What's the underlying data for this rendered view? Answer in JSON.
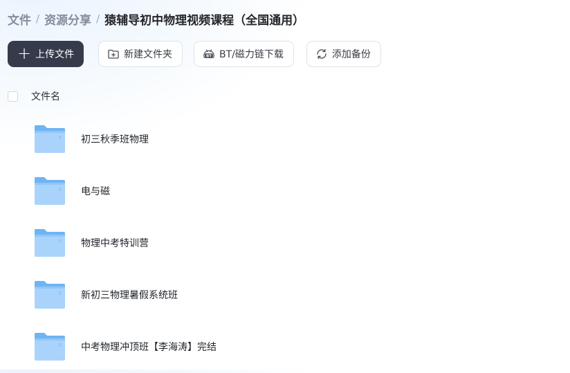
{
  "breadcrumb": {
    "items": [
      "文件",
      "资源分享"
    ],
    "separator": "/",
    "current": "猿辅导初中物理视频课程（全国通用）"
  },
  "toolbar": {
    "upload_label": "上传文件",
    "new_folder_label": "新建文件夹",
    "bt_label": "BT/磁力链下载",
    "backup_label": "添加备份"
  },
  "list": {
    "column_name": "文件名",
    "files": [
      {
        "name": "初三秋季班物理",
        "type": "folder"
      },
      {
        "name": "电与磁",
        "type": "folder"
      },
      {
        "name": "物理中考特训营",
        "type": "folder"
      },
      {
        "name": "新初三物理暑假系统班",
        "type": "folder"
      },
      {
        "name": "中考物理冲顶班【李海涛】完结",
        "type": "folder"
      }
    ]
  },
  "colors": {
    "primary_button": "#363b4c",
    "folder_light": "#a9d3fb",
    "folder_dark": "#6fb4f3"
  },
  "icons": {
    "upload": "plus-icon",
    "new_folder": "folder-plus-icon",
    "bt": "bt-icon",
    "backup": "refresh-icon",
    "file": "folder-icon"
  }
}
